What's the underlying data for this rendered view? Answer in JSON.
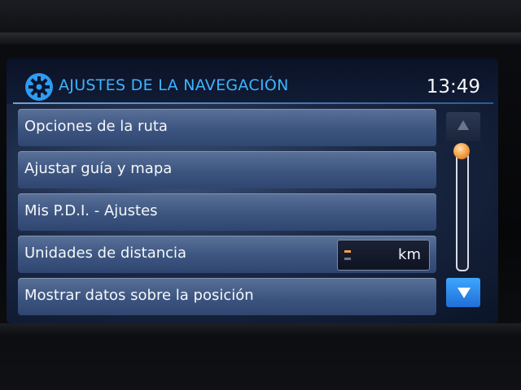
{
  "header": {
    "title": "AJUSTES DE LA NAVEGACIÓN",
    "time": "13:49",
    "icon": "gear-icon"
  },
  "menu": {
    "items": [
      {
        "label": "Opciones de la ruta"
      },
      {
        "label": "Ajustar guía y mapa"
      },
      {
        "label": "Mis P.D.I. - Ajustes"
      },
      {
        "label": "Unidades de distancia",
        "value": "km"
      },
      {
        "label": "Mostrar datos sobre la posición"
      }
    ]
  },
  "scrollbar": {
    "up_icon": "up-arrow-icon",
    "down_icon": "down-arrow-icon",
    "position": 0.0
  },
  "colors": {
    "title": "#3fb4ff",
    "accent_thumb": "#f39a3c",
    "active_arrow": "#2f8cf0"
  }
}
